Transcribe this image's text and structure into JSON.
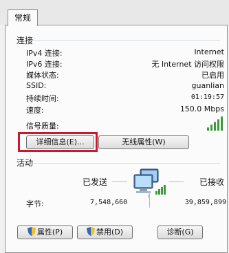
{
  "tab": {
    "label": "常规"
  },
  "connection": {
    "title": "连接",
    "rows": [
      {
        "label": "IPv4 连接:",
        "value": "Internet"
      },
      {
        "label": "IPv6 连接:",
        "value": "无 Internet 访问权限"
      },
      {
        "label": "媒体状态:",
        "value": "已启用"
      },
      {
        "label": "SSID:",
        "value": "guanlian"
      },
      {
        "label": "持续时间:",
        "value": "01:19:57"
      },
      {
        "label": "速度:",
        "value": "150.0 Mbps"
      }
    ],
    "signal_label": "信号质量:",
    "signal_bars_lit": 5,
    "signal_bars_total": 5
  },
  "buttons": {
    "details": "详细信息(E)...",
    "wireless_props": "无线属性(W)",
    "properties": "属性(P)",
    "disable": "禁用(D)",
    "diagnose": "诊断(G)"
  },
  "activity": {
    "title": "活动",
    "sent_label": "已发送",
    "received_label": "已接收",
    "bytes_label": "字节:",
    "bytes_sent": "7,548,660",
    "bytes_received": "39,859,899"
  },
  "colors": {
    "highlight": "#d0162b",
    "signal": "#3d9a3a",
    "separator": "#d5dfe5"
  }
}
